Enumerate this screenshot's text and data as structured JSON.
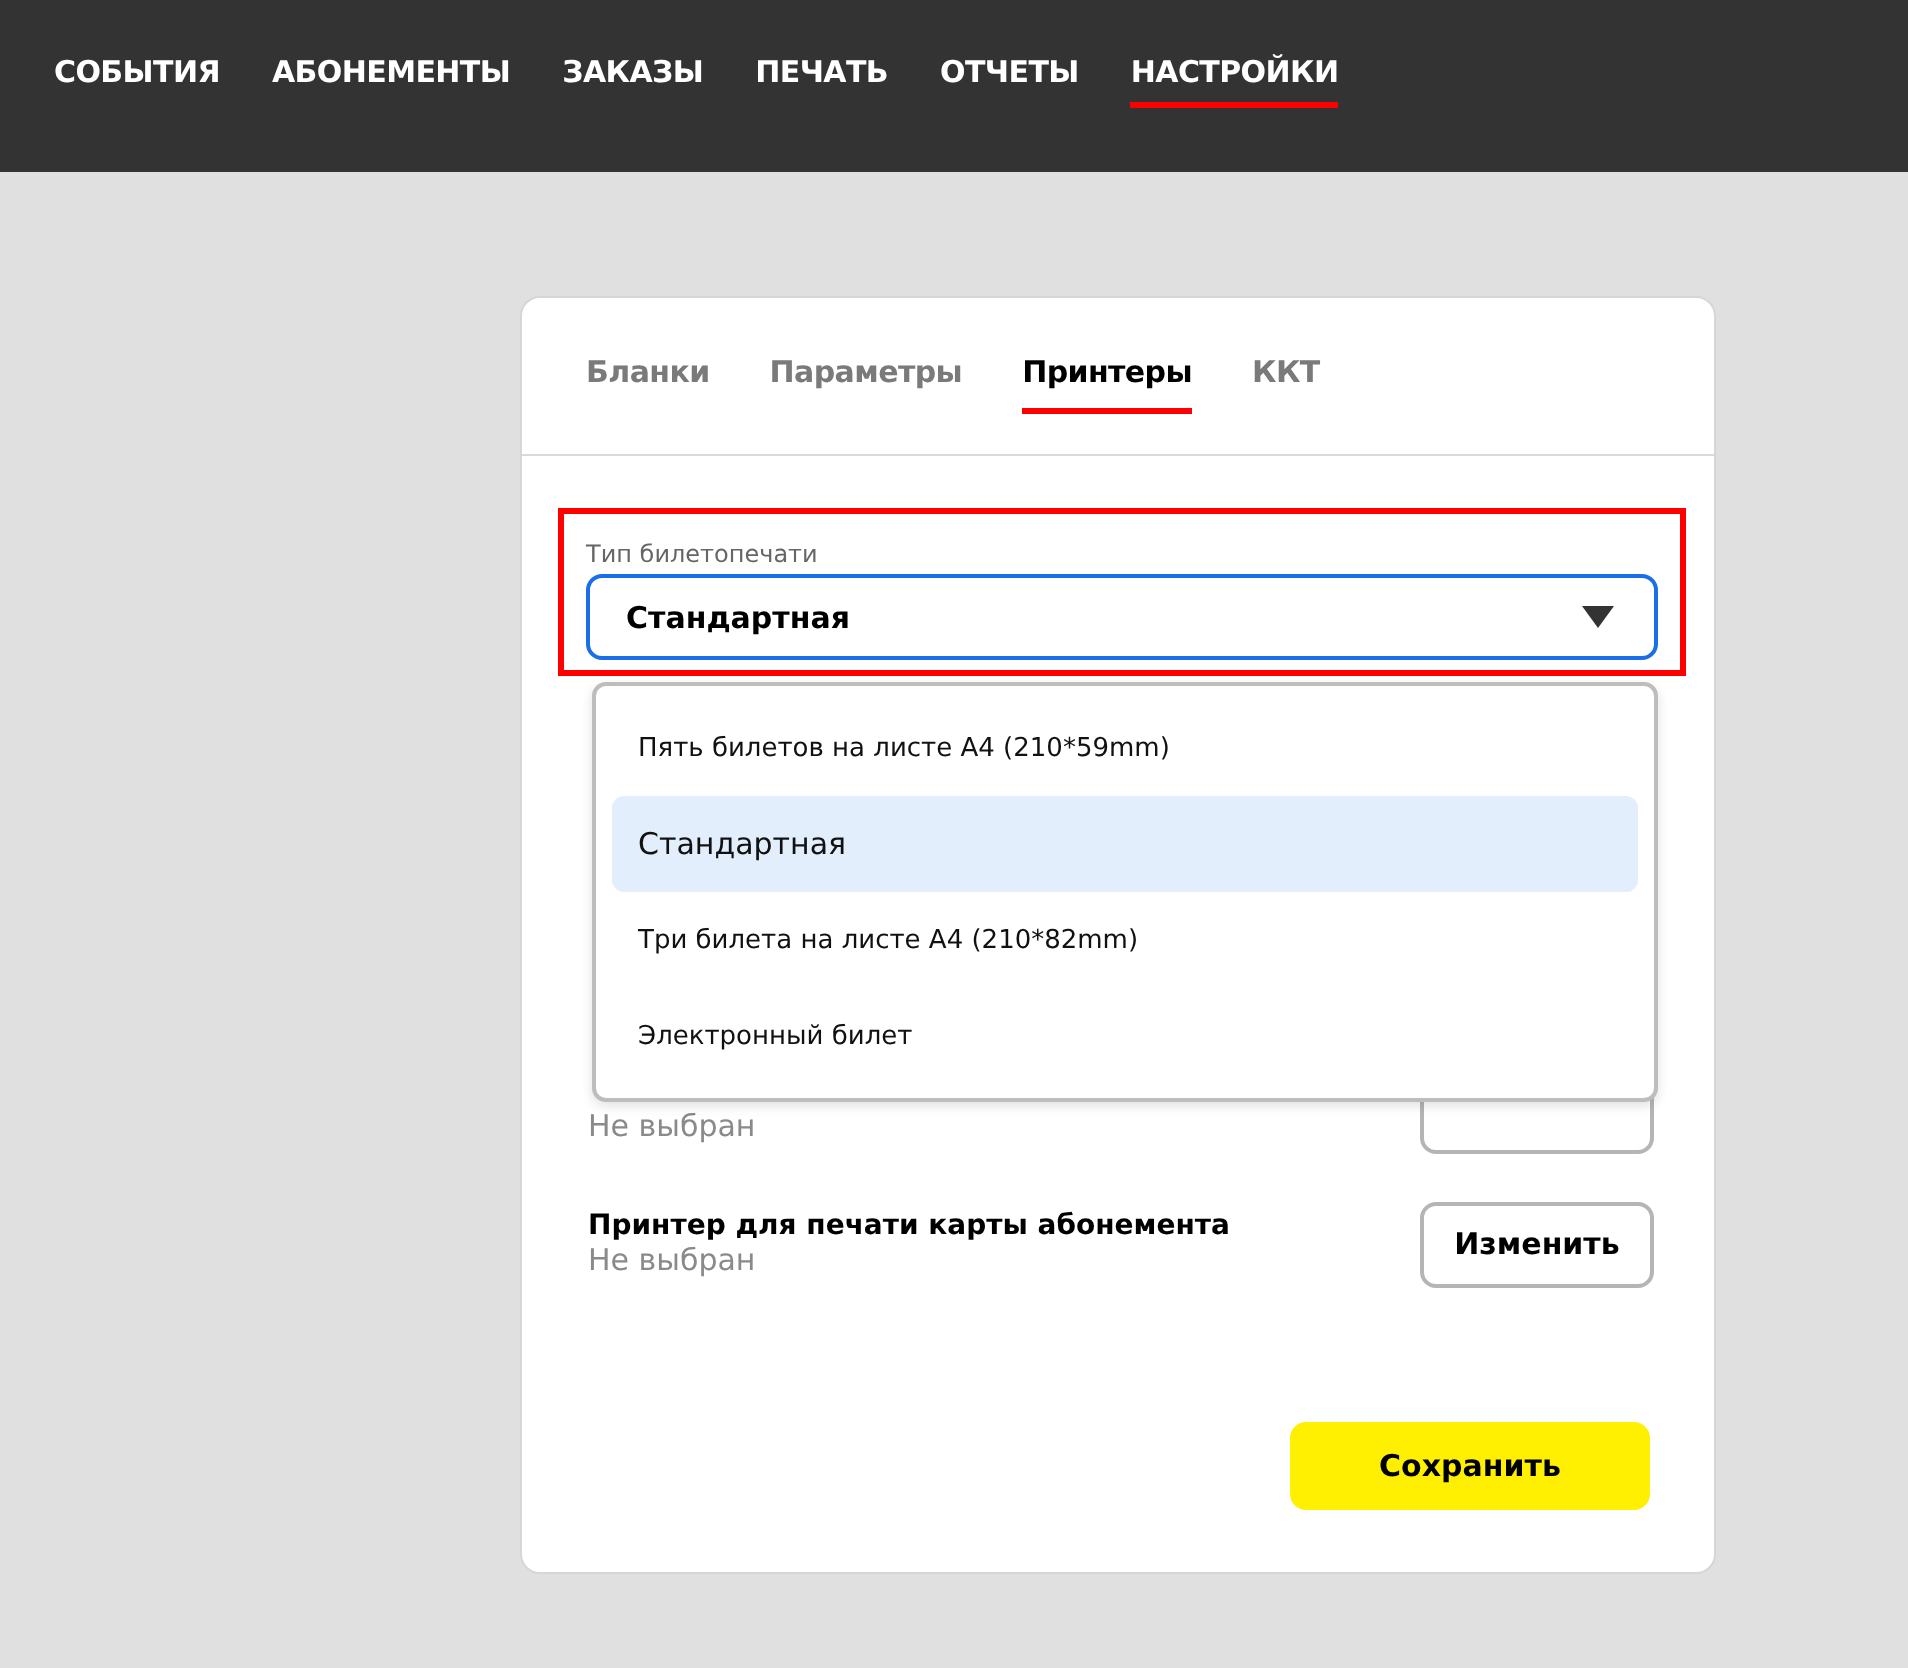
{
  "nav": [
    {
      "label": "СОБЫТИЯ",
      "selected": false
    },
    {
      "label": "АБОНЕМЕНТЫ",
      "selected": false
    },
    {
      "label": "ЗАКАЗЫ",
      "selected": false
    },
    {
      "label": "ПЕЧАТЬ",
      "selected": false
    },
    {
      "label": "ОТЧЕТЫ",
      "selected": false
    },
    {
      "label": "НАСТРОЙКИ",
      "selected": true
    }
  ],
  "tabs": [
    {
      "label": "Бланки",
      "selected": false
    },
    {
      "label": "Параметры",
      "selected": false
    },
    {
      "label": "Принтеры",
      "selected": true
    },
    {
      "label": "ККТ",
      "selected": false
    }
  ],
  "ticket_type": {
    "label": "Тип билетопечати",
    "value": "Стандартная",
    "highlighted": true,
    "expanded": true,
    "options": [
      {
        "label": "Пять билетов на листе А4 (210*59mm)",
        "selected": false
      },
      {
        "label": "Стандартная",
        "selected": true
      },
      {
        "label": "Три билета на листе А4 (210*82mm)",
        "selected": false
      },
      {
        "label": "Электронный билет",
        "selected": false
      }
    ]
  },
  "printers": [
    {
      "status": "Не выбран"
    },
    {
      "title": "Принтер для печати карты абонемента",
      "status": "Не выбран",
      "button": "Изменить"
    }
  ],
  "save_button": "Сохранить"
}
